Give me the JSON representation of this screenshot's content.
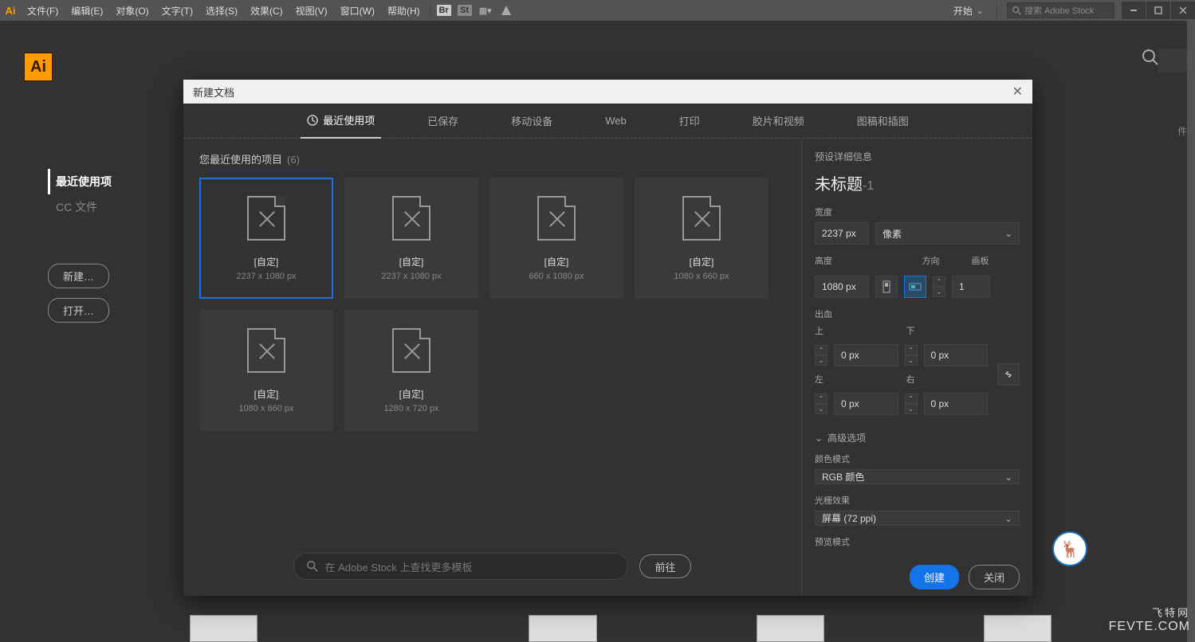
{
  "menubar": {
    "items": [
      "文件(F)",
      "编辑(E)",
      "对象(O)",
      "文字(T)",
      "选择(S)",
      "效果(C)",
      "视图(V)",
      "窗口(W)",
      "帮助(H)"
    ],
    "start": "开始",
    "stock_placeholder": "搜索 Adobe Stock"
  },
  "app": {
    "logo": "Ai"
  },
  "left_nav": {
    "items": [
      "最近使用项",
      "CC 文件"
    ],
    "buttons": [
      "新建…",
      "打开…"
    ]
  },
  "dialog": {
    "title": "新建文档",
    "tabs": [
      "最近使用项",
      "已保存",
      "移动设备",
      "Web",
      "打印",
      "胶片和视频",
      "图稿和插图"
    ],
    "recent_label": "您最近使用的项目",
    "recent_count": "(6)",
    "presets": [
      {
        "name": "[自定]",
        "dim": "2237 x 1080 px"
      },
      {
        "name": "[自定]",
        "dim": "2237 x 1080 px"
      },
      {
        "name": "[自定]",
        "dim": "660 x 1080 px"
      },
      {
        "name": "[自定]",
        "dim": "1080 x 660 px"
      },
      {
        "name": "[自定]",
        "dim": "1080 x 660 px"
      },
      {
        "name": "[自定]",
        "dim": "1280 x 720 px"
      }
    ],
    "stock_search_placeholder": "在 Adobe Stock 上查找更多模板",
    "go_label": "前往"
  },
  "detail": {
    "section_title": "预设详细信息",
    "doc_title": "未标题",
    "doc_title_suffix": "-1",
    "width_label": "宽度",
    "width_value": "2237 px",
    "unit_label": "像素",
    "height_label": "高度",
    "height_value": "1080 px",
    "orient_label": "方向",
    "artboard_label": "画板",
    "artboard_value": "1",
    "bleed_label": "出血",
    "bleed_top_label": "上",
    "bleed_bottom_label": "下",
    "bleed_left_label": "左",
    "bleed_right_label": "右",
    "bleed_value": "0 px",
    "advanced_label": "高级选项",
    "color_mode_label": "颜色模式",
    "color_mode_value": "RGB 颜色",
    "raster_label": "光栅效果",
    "raster_value": "屏幕 (72 ppi)",
    "preview_label": "预览模式",
    "create_label": "创建",
    "close_label": "关闭"
  },
  "watermark": {
    "site_cn": "飞特网",
    "site_en": "FEVTE.COM"
  }
}
